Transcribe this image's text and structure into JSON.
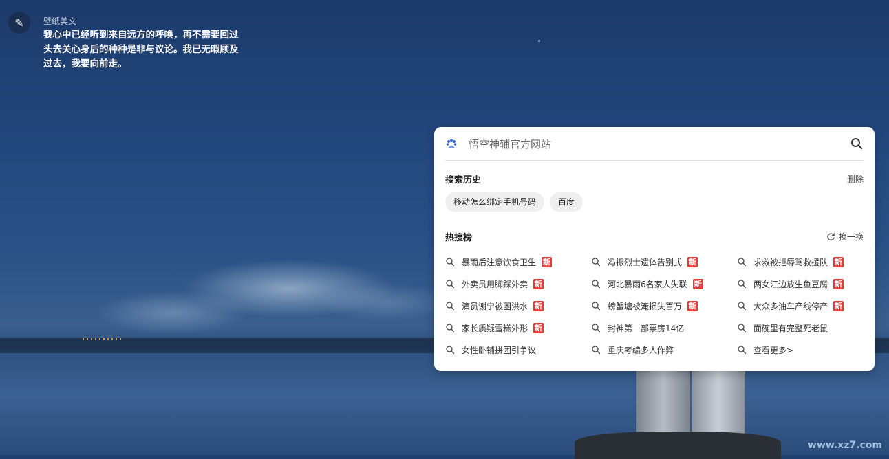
{
  "quote": {
    "icon": "quill-icon",
    "title": "壁纸美文",
    "text": "我心中已经听到来自远方的呼唤，再不需要回过头去关心身后的种种是非与议论。我已无暇顾及过去，我要向前走。"
  },
  "search": {
    "engine_icon": "baidu-paw-icon",
    "placeholder": "悟空神辅官方网站",
    "value": ""
  },
  "history": {
    "title": "搜索历史",
    "delete_label": "删除",
    "items": [
      "移动怎么绑定手机号码",
      "百度"
    ]
  },
  "hot": {
    "title": "热搜榜",
    "refresh_label": "换一换",
    "new_badge": "新",
    "items": [
      {
        "text": "暴雨后注意饮食卫生",
        "new": true
      },
      {
        "text": "冯振烈士遗体告别式",
        "new": true
      },
      {
        "text": "求救被拒辱骂救援队",
        "new": true
      },
      {
        "text": "外卖员用脚踩外卖",
        "new": true
      },
      {
        "text": "河北暴雨6名家人失联",
        "new": true
      },
      {
        "text": "两女江边放生鱼豆腐",
        "new": true
      },
      {
        "text": "演员谢宁被困洪水",
        "new": true
      },
      {
        "text": "螃蟹塘被淹损失百万",
        "new": true
      },
      {
        "text": "大众多油车产线停产",
        "new": true
      },
      {
        "text": "家长质疑雪糕外形",
        "new": true
      },
      {
        "text": "封神第一部票房14亿",
        "new": false
      },
      {
        "text": "面碗里有完整死老鼠",
        "new": false
      },
      {
        "text": "女性卧铺拼团引争议",
        "new": false
      },
      {
        "text": "重庆考编多人作弊",
        "new": false
      },
      {
        "text": "查看更多>",
        "new": false
      }
    ]
  },
  "watermark": "www.xz7.com",
  "colors": {
    "accent": "#3b6fd6",
    "badge": "#e43b3b"
  }
}
